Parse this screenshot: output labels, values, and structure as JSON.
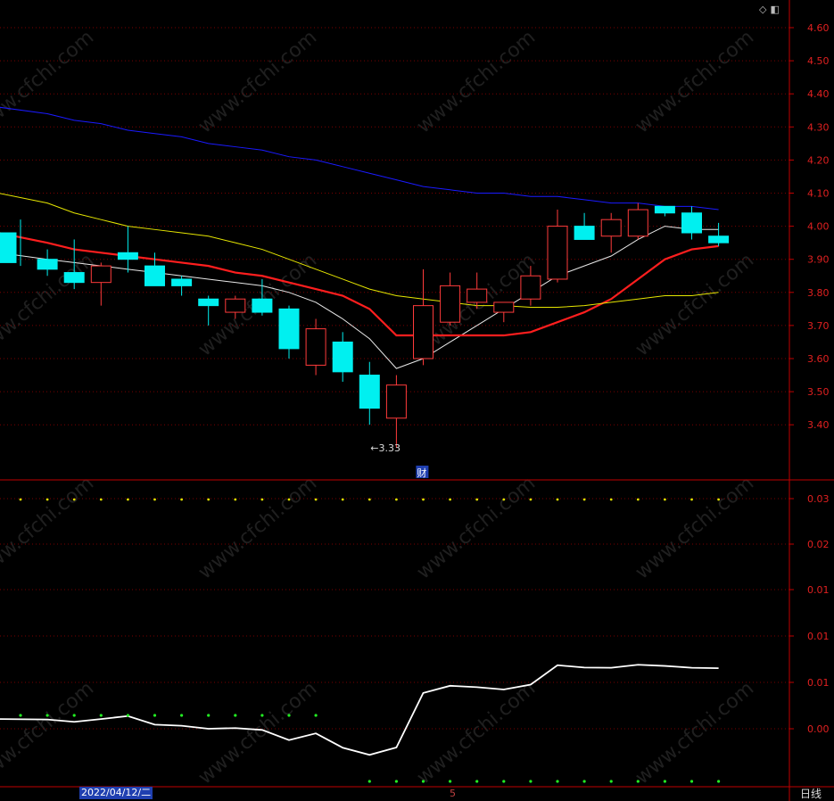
{
  "toolbar": {
    "diamond_icon": "diamond-icon",
    "panel_icon": "panel-toggle-icon"
  },
  "footer": {
    "date": "2022/04/12/二",
    "period": "日线",
    "x_tick": "5"
  },
  "watermark": "www.cfchi.com",
  "colors": {
    "up": "#ff3b3b",
    "down": "#00f0f0",
    "ma_white": "#e8e8e8",
    "ma_red": "#ff1e1e",
    "ma_yellow": "#e6e600",
    "ma_blue": "#1a1aff",
    "axis": "#c00000",
    "grid": "#7a0000",
    "indicator": "#ffffff",
    "dot_yellow": "#e0e000",
    "dot_green": "#22ee22"
  },
  "chart_data": [
    {
      "type": "candlestick",
      "ylim": [
        3.28,
        4.64
      ],
      "yticks": [
        "4.60",
        "4.50",
        "4.40",
        "4.30",
        "4.20",
        "4.10",
        "4.00",
        "3.90",
        "3.80",
        "3.70",
        "3.60",
        "3.50",
        "3.40"
      ],
      "min_marker": {
        "index": 13,
        "label": "←3.33",
        "value": 3.33
      },
      "event_marker": {
        "index": 14,
        "label": "财"
      },
      "candles": [
        {
          "o": 3.98,
          "h": 4.02,
          "l": 3.88,
          "c": 3.89
        },
        {
          "o": 3.9,
          "h": 3.93,
          "l": 3.85,
          "c": 3.87
        },
        {
          "o": 3.86,
          "h": 3.96,
          "l": 3.81,
          "c": 3.83
        },
        {
          "o": 3.83,
          "h": 3.89,
          "l": 3.76,
          "c": 3.88
        },
        {
          "o": 3.92,
          "h": 4.0,
          "l": 3.86,
          "c": 3.9
        },
        {
          "o": 3.88,
          "h": 3.92,
          "l": 3.82,
          "c": 3.82
        },
        {
          "o": 3.84,
          "h": 3.85,
          "l": 3.79,
          "c": 3.82
        },
        {
          "o": 3.78,
          "h": 3.79,
          "l": 3.7,
          "c": 3.76
        },
        {
          "o": 3.74,
          "h": 3.79,
          "l": 3.72,
          "c": 3.78
        },
        {
          "o": 3.78,
          "h": 3.84,
          "l": 3.73,
          "c": 3.74
        },
        {
          "o": 3.75,
          "h": 3.76,
          "l": 3.6,
          "c": 3.63
        },
        {
          "o": 3.58,
          "h": 3.72,
          "l": 3.55,
          "c": 3.69
        },
        {
          "o": 3.65,
          "h": 3.68,
          "l": 3.53,
          "c": 3.56
        },
        {
          "o": 3.55,
          "h": 3.59,
          "l": 3.4,
          "c": 3.45
        },
        {
          "o": 3.42,
          "h": 3.55,
          "l": 3.33,
          "c": 3.52
        },
        {
          "o": 3.6,
          "h": 3.87,
          "l": 3.58,
          "c": 3.76
        },
        {
          "o": 3.71,
          "h": 3.86,
          "l": 3.7,
          "c": 3.82
        },
        {
          "o": 3.77,
          "h": 3.86,
          "l": 3.75,
          "c": 3.81
        },
        {
          "o": 3.74,
          "h": 3.77,
          "l": 3.71,
          "c": 3.77
        },
        {
          "o": 3.78,
          "h": 3.88,
          "l": 3.76,
          "c": 3.85
        },
        {
          "o": 3.84,
          "h": 4.05,
          "l": 3.83,
          "c": 4.0
        },
        {
          "o": 4.0,
          "h": 4.04,
          "l": 3.96,
          "c": 3.96
        },
        {
          "o": 3.97,
          "h": 4.04,
          "l": 3.92,
          "c": 4.02
        },
        {
          "o": 3.97,
          "h": 4.07,
          "l": 3.96,
          "c": 4.05
        },
        {
          "o": 4.06,
          "h": 4.06,
          "l": 4.03,
          "c": 4.04
        },
        {
          "o": 4.04,
          "h": 4.06,
          "l": 3.96,
          "c": 3.98
        },
        {
          "o": 3.97,
          "h": 4.01,
          "l": 3.94,
          "c": 3.95
        }
      ],
      "ma_lines": [
        {
          "color_key": "ma_white",
          "values": [
            3.92,
            3.9,
            3.89,
            3.88,
            3.87,
            3.86,
            3.85,
            3.84,
            3.83,
            3.82,
            3.8,
            3.77,
            3.72,
            3.66,
            3.57,
            3.6,
            3.65,
            3.7,
            3.75,
            3.8,
            3.85,
            3.88,
            3.91,
            3.96,
            4.0,
            3.99,
            3.99
          ]
        },
        {
          "color_key": "ma_red",
          "values": [
            3.98,
            3.95,
            3.93,
            3.92,
            3.91,
            3.9,
            3.89,
            3.88,
            3.86,
            3.85,
            3.83,
            3.81,
            3.79,
            3.75,
            3.67,
            3.67,
            3.67,
            3.67,
            3.67,
            3.68,
            3.71,
            3.74,
            3.78,
            3.84,
            3.9,
            3.93,
            3.94
          ]
        },
        {
          "color_key": "ma_yellow",
          "values": [
            4.1,
            4.07,
            4.04,
            4.02,
            4.0,
            3.99,
            3.98,
            3.97,
            3.95,
            3.93,
            3.9,
            3.87,
            3.84,
            3.81,
            3.79,
            3.78,
            3.77,
            3.76,
            3.76,
            3.755,
            3.755,
            3.76,
            3.77,
            3.78,
            3.79,
            3.79,
            3.8
          ]
        },
        {
          "color_key": "ma_blue",
          "values": [
            4.36,
            4.34,
            4.32,
            4.31,
            4.29,
            4.28,
            4.27,
            4.25,
            4.24,
            4.23,
            4.21,
            4.2,
            4.18,
            4.16,
            4.14,
            4.12,
            4.11,
            4.1,
            4.1,
            4.09,
            4.09,
            4.08,
            4.07,
            4.07,
            4.06,
            4.06,
            4.05
          ]
        }
      ]
    },
    {
      "type": "line",
      "yticks": [
        "0.03",
        "0.02",
        "0.01",
        "0.01",
        "0.01",
        "0.00"
      ],
      "values": [
        0.0042,
        0.004,
        0.003,
        0.0042,
        0.0055,
        0.0018,
        0.0013,
        0.0,
        0.0003,
        -0.0005,
        -0.0049,
        -0.002,
        -0.0082,
        -0.0113,
        -0.0081,
        0.0155,
        0.0186,
        0.018,
        0.017,
        0.0191,
        0.0275,
        0.0265,
        0.0264,
        0.0277,
        0.0272,
        0.0264,
        0.0262
      ],
      "dots_top": "yellow",
      "dots_bottom": [
        "green",
        "green",
        "green",
        "green",
        "green",
        "green",
        "green",
        "green",
        "green",
        "green",
        "green",
        "green",
        "none",
        "green",
        "green",
        "green",
        "green",
        "green",
        "green",
        "green",
        "green",
        "green",
        "green",
        "green",
        "green",
        "green",
        "green"
      ],
      "dots_bottom_row": [
        0,
        0,
        0,
        0,
        0,
        0,
        0,
        0,
        0,
        0,
        0,
        0,
        1,
        1,
        1,
        1,
        1,
        1,
        1,
        1,
        1,
        1,
        1,
        1,
        1,
        1,
        1
      ]
    }
  ]
}
